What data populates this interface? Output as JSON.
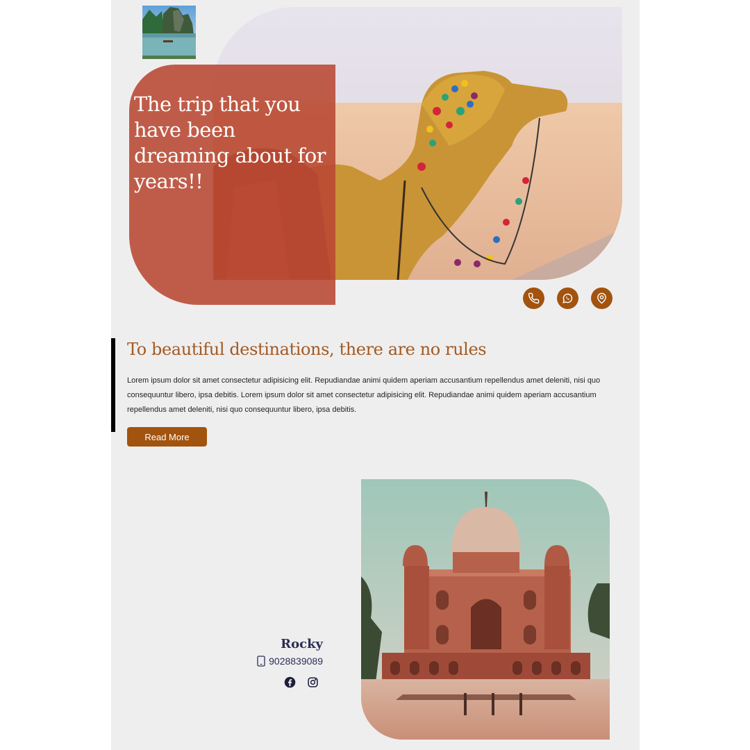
{
  "hero": {
    "title": "The trip that you have been dreaming about for years!!"
  },
  "contact_icons": [
    "phone-icon",
    "whatsapp-icon",
    "map-pin-icon"
  ],
  "intro": {
    "title": "To beautiful destinations, there are no rules",
    "body": "Lorem ipsum dolor sit amet consectetur adipisicing elit. Repudiandae animi quidem aperiam accusantium repellendus amet deleniti, nisi quo consequuntur libero, ipsa debitis. Lorem ipsum dolor sit amet consectetur adipisicing elit. Repudiandae animi quidem aperiam accusantium repellendus amet deleniti, nisi quo consequuntur libero, ipsa debitis.",
    "button_label": "Read More"
  },
  "contact": {
    "name": "Rocky",
    "phone": "9028839089",
    "social": [
      "facebook-icon",
      "instagram-icon"
    ]
  },
  "colors": {
    "accent": "#a2530e",
    "overlay": "#b84832",
    "heading": "#a25a23",
    "navy": "#2b2d55",
    "page_bg": "#efeeef"
  }
}
